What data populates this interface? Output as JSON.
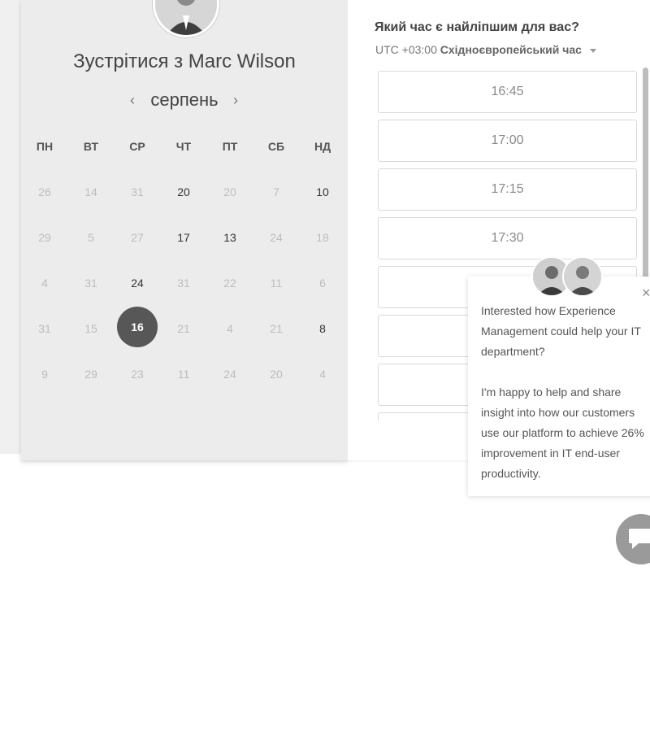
{
  "header": {
    "meet_title": "Зустрітися з Marc Wilson"
  },
  "calendar": {
    "month": "серпень",
    "weekdays": [
      "ПН",
      "ВТ",
      "СР",
      "ЧТ",
      "ПТ",
      "СБ",
      "НД"
    ],
    "weeks": [
      [
        {
          "d": "26",
          "a": false
        },
        {
          "d": "14",
          "a": false
        },
        {
          "d": "31",
          "a": false
        },
        {
          "d": "20",
          "a": true
        },
        {
          "d": "20",
          "a": false
        },
        {
          "d": "7",
          "a": false
        },
        {
          "d": "10",
          "a": true
        }
      ],
      [
        {
          "d": "29",
          "a": false
        },
        {
          "d": "5",
          "a": false
        },
        {
          "d": "27",
          "a": false
        },
        {
          "d": "17",
          "a": true
        },
        {
          "d": "13",
          "a": true
        },
        {
          "d": "24",
          "a": false
        },
        {
          "d": "18",
          "a": false
        }
      ],
      [
        {
          "d": "4",
          "a": false
        },
        {
          "d": "31",
          "a": false
        },
        {
          "d": "24",
          "a": true
        },
        {
          "d": "31",
          "a": false
        },
        {
          "d": "22",
          "a": false
        },
        {
          "d": "11",
          "a": false
        },
        {
          "d": "6",
          "a": false
        }
      ],
      [
        {
          "d": "31",
          "a": false
        },
        {
          "d": "15",
          "a": false
        },
        {
          "d": "16",
          "a": true,
          "sel": true
        },
        {
          "d": "21",
          "a": false
        },
        {
          "d": "4",
          "a": false
        },
        {
          "d": "21",
          "a": false
        },
        {
          "d": "8",
          "a": true
        }
      ],
      [
        {
          "d": "9",
          "a": false
        },
        {
          "d": "29",
          "a": false
        },
        {
          "d": "23",
          "a": false
        },
        {
          "d": "11",
          "a": false
        },
        {
          "d": "24",
          "a": false
        },
        {
          "d": "20",
          "a": false
        },
        {
          "d": "4",
          "a": false
        }
      ]
    ]
  },
  "times": {
    "question": "Який час є найліпшим для вас?",
    "tz_offset": "UTC +03:00",
    "tz_name": "Східноєвропейський час",
    "slots": [
      "16:45",
      "17:00",
      "17:15",
      "17:30",
      "",
      "",
      "",
      ""
    ]
  },
  "chat": {
    "message_1": "Interested how Experience Management could help your IT department?",
    "message_2": "I'm happy to help and share insight into how our customers use our platform to achieve 26% improvement in IT end-user productivity.",
    "close_label": "×"
  }
}
